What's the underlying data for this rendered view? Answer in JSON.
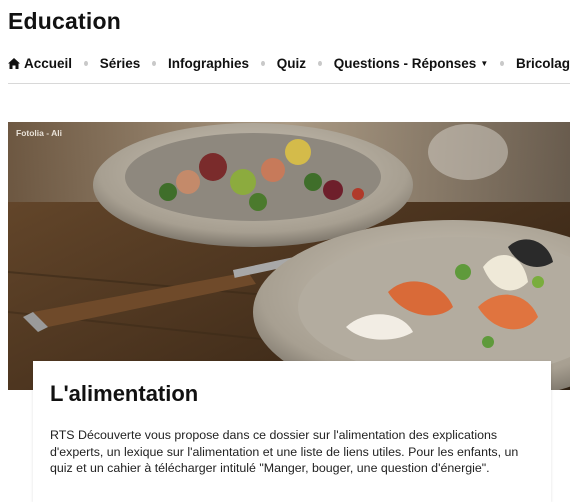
{
  "site": {
    "title": "Education"
  },
  "nav": {
    "items": [
      {
        "label": "Accueil",
        "icon": "home-icon"
      },
      {
        "label": "Séries"
      },
      {
        "label": "Infographies"
      },
      {
        "label": "Quiz"
      },
      {
        "label": "Questions - Réponses",
        "icon": "chevron-down-icon"
      },
      {
        "label": "Bricolag"
      }
    ]
  },
  "hero": {
    "credit": "Fotolia - Ali"
  },
  "article": {
    "title": "L'alimentation",
    "intro": "RTS Découverte vous propose dans ce dossier sur l'alimentation des explications d'experts, un lexique sur l'alimentation et une liste de liens utiles. Pour les enfants, un quiz et un cahier à télécharger intitulé \"Manger, bouger, une question d'énergie\"."
  }
}
